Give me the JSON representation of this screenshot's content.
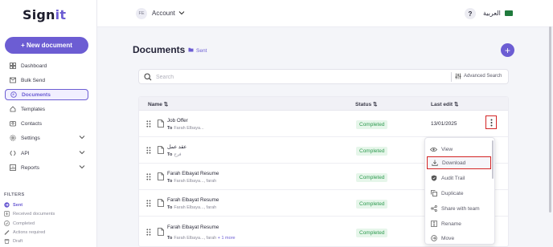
{
  "sidebar": {
    "logo_main": "Sign",
    "logo_accent": "it",
    "new_document_label": "+ New document",
    "items": [
      {
        "label": "Dashboard",
        "icon": "dashboard-icon"
      },
      {
        "label": "Bulk Send",
        "icon": "bulk-send-icon"
      },
      {
        "label": "Documents",
        "icon": "documents-icon",
        "active": true
      },
      {
        "label": "Templates",
        "icon": "templates-icon"
      },
      {
        "label": "Contacts",
        "icon": "contacts-icon"
      },
      {
        "label": "Settings",
        "icon": "settings-icon",
        "expandable": true
      },
      {
        "label": "API",
        "icon": "api-icon",
        "expandable": true
      },
      {
        "label": "Reports",
        "icon": "reports-icon",
        "expandable": true
      }
    ],
    "filters_title": "FILTERS",
    "filters": [
      {
        "label": "Sent",
        "icon": "sent-icon",
        "active": true
      },
      {
        "label": "Received documents",
        "icon": "received-icon"
      },
      {
        "label": "Completed",
        "icon": "completed-icon"
      },
      {
        "label": "Actions required",
        "icon": "actions-required-icon"
      },
      {
        "label": "Draft",
        "icon": "draft-icon"
      }
    ]
  },
  "topbar": {
    "avatar_initials": "FE",
    "account_label": "Account",
    "help_label": "?",
    "language_label": "العربية"
  },
  "main": {
    "title": "Documents",
    "breadcrumb": "Sent",
    "add_button_label": "+",
    "search_placeholder": "Search",
    "advanced_search_label": "Advanced Search",
    "columns": {
      "name": "Name",
      "status": "Status",
      "last_edit": "Last edit"
    },
    "rows": [
      {
        "title": "Job Offer",
        "to_prefix": "To",
        "to": "Farah Elbaya...",
        "more": "",
        "status": "Completed",
        "last_edit": "13/01/2025"
      },
      {
        "title": "عقد عمل",
        "to_prefix": "To",
        "to": "فرح",
        "more": "",
        "status": "Completed",
        "last_edit": ""
      },
      {
        "title": "Farah Elbayat Resume",
        "to_prefix": "To",
        "to": "Farah Elbaya..., farah",
        "more": "",
        "status": "Completed",
        "last_edit": ""
      },
      {
        "title": "Farah Elbayat Resume",
        "to_prefix": "To",
        "to": "Farah Elbaya..., farah",
        "more": "",
        "status": "Completed",
        "last_edit": ""
      },
      {
        "title": "Farah Elbayat Resume",
        "to_prefix": "To",
        "to": "Farah Elbaya..., farah",
        "more": "+ 1 more",
        "status": "Completed",
        "last_edit": ""
      }
    ]
  },
  "menu": {
    "items": [
      {
        "label": "View",
        "icon": "eye-icon"
      },
      {
        "label": "Download",
        "icon": "download-icon",
        "highlighted": true
      },
      {
        "label": "Audit Trail",
        "icon": "audit-trail-icon"
      },
      {
        "label": "Duplicate",
        "icon": "duplicate-icon"
      },
      {
        "label": "Share with team",
        "icon": "share-icon"
      },
      {
        "label": "Rename",
        "icon": "rename-icon"
      },
      {
        "label": "Move",
        "icon": "move-icon"
      }
    ]
  },
  "colors": {
    "brand": "#6c5dd3",
    "status_completed_bg": "#e6f6ea",
    "status_completed_text": "#2e9a4f",
    "highlight_border": "#d32424"
  }
}
